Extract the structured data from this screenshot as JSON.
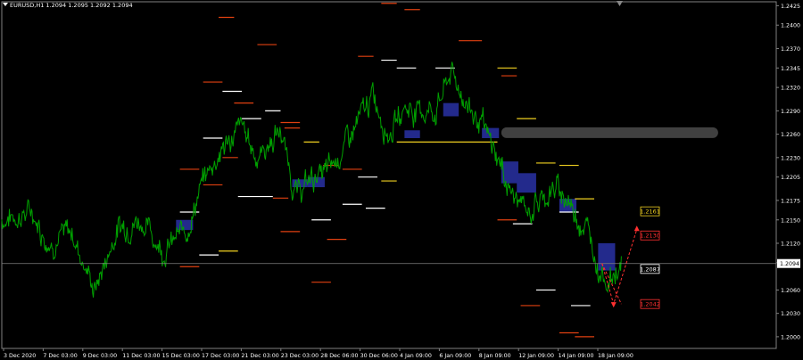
{
  "header": {
    "title": "EURUSD,H1  1.2094 1.2095 1.2092 1.2094"
  },
  "colors": {
    "background": "#000000",
    "price_line": "#00a000",
    "grid_frame": "#808080",
    "axis_text": "#ffffff",
    "blue_box": "#232a8c",
    "red_level": "#e04010",
    "white_level": "#ffffff",
    "yellow_level": "#f0d020",
    "forecast_red": "#ff3030",
    "gray_band": "#404040"
  },
  "icons": {
    "scroll": "chart-shift-icon"
  },
  "chart_data": {
    "type": "line",
    "symbol": "EURUSD",
    "timeframe": "H1",
    "ylim": [
      1.1985,
      1.243
    ],
    "y_ticks": [
      "1.2425",
      "1.2400",
      "1.2370",
      "1.2345",
      "1.2320",
      "1.2290",
      "1.2260",
      "1.2230",
      "1.2205",
      "1.2175",
      "1.2150",
      "1.2120",
      "1.2095",
      "1.2060",
      "1.2030",
      "1.2000"
    ],
    "x_ticks": [
      "3 Dec 2020",
      "7 Dec 03:00",
      "9 Dec 03:00",
      "11 Dec 03:00",
      "15 Dec 03:00",
      "17 Dec 03:00",
      "21 Dec 03:00",
      "23 Dec 03:00",
      "28 Dec 06:00",
      "30 Dec 06:00",
      "4 Jan 09:00",
      "6 Jan 09:00",
      "8 Jan 09:00",
      "12 Jan 09:00",
      "14 Jan 09:00",
      "18 Jan 09:00"
    ],
    "current_price": "1.2094",
    "price_labels": [
      {
        "text": "1.2161",
        "value": 1.2161,
        "color": "#f0d020"
      },
      {
        "text": "1.2130",
        "value": 1.213,
        "color": "#ff3030"
      },
      {
        "text": "1.2087",
        "value": 1.2087,
        "color": "#ffffff"
      },
      {
        "text": "1.2042",
        "value": 1.2042,
        "color": "#ff3030"
      }
    ],
    "price_anchors": [
      {
        "x": 0,
        "y": 1.215
      },
      {
        "x": 0.04,
        "y": 1.216
      },
      {
        "x": 0.06,
        "y": 1.212
      },
      {
        "x": 0.09,
        "y": 1.2135
      },
      {
        "x": 0.12,
        "y": 1.206
      },
      {
        "x": 0.15,
        "y": 1.214
      },
      {
        "x": 0.18,
        "y": 1.215
      },
      {
        "x": 0.21,
        "y": 1.211
      },
      {
        "x": 0.24,
        "y": 1.214
      },
      {
        "x": 0.26,
        "y": 1.22
      },
      {
        "x": 0.28,
        "y": 1.2235
      },
      {
        "x": 0.31,
        "y": 1.227
      },
      {
        "x": 0.33,
        "y": 1.223
      },
      {
        "x": 0.36,
        "y": 1.2265
      },
      {
        "x": 0.38,
        "y": 1.218
      },
      {
        "x": 0.4,
        "y": 1.2205
      },
      {
        "x": 0.42,
        "y": 1.221
      },
      {
        "x": 0.44,
        "y": 1.224
      },
      {
        "x": 0.46,
        "y": 1.2275
      },
      {
        "x": 0.48,
        "y": 1.231
      },
      {
        "x": 0.5,
        "y": 1.226
      },
      {
        "x": 0.52,
        "y": 1.2295
      },
      {
        "x": 0.54,
        "y": 1.229
      },
      {
        "x": 0.56,
        "y": 1.229
      },
      {
        "x": 0.58,
        "y": 1.234
      },
      {
        "x": 0.6,
        "y": 1.23
      },
      {
        "x": 0.62,
        "y": 1.227
      },
      {
        "x": 0.64,
        "y": 1.223
      },
      {
        "x": 0.66,
        "y": 1.218
      },
      {
        "x": 0.68,
        "y": 1.216
      },
      {
        "x": 0.7,
        "y": 1.218
      },
      {
        "x": 0.72,
        "y": 1.219
      },
      {
        "x": 0.74,
        "y": 1.216
      },
      {
        "x": 0.76,
        "y": 1.213
      },
      {
        "x": 0.77,
        "y": 1.209
      },
      {
        "x": 0.785,
        "y": 1.207
      },
      {
        "x": 0.8,
        "y": 1.2094
      }
    ],
    "levels": [
      {
        "x": 0.49,
        "w": 0.02,
        "y": 1.2428,
        "color": "red"
      },
      {
        "x": 0.52,
        "w": 0.02,
        "y": 1.242,
        "color": "red"
      },
      {
        "x": 0.28,
        "w": 0.02,
        "y": 1.241,
        "color": "red"
      },
      {
        "x": 0.59,
        "w": 0.03,
        "y": 1.238,
        "color": "red"
      },
      {
        "x": 0.33,
        "w": 0.025,
        "y": 1.2375,
        "color": "red"
      },
      {
        "x": 0.46,
        "w": 0.02,
        "y": 1.236,
        "color": "red"
      },
      {
        "x": 0.49,
        "w": 0.02,
        "y": 1.2355,
        "color": "white"
      },
      {
        "x": 0.51,
        "w": 0.025,
        "y": 1.2345,
        "color": "white"
      },
      {
        "x": 0.56,
        "w": 0.025,
        "y": 1.2345,
        "color": "white"
      },
      {
        "x": 0.64,
        "w": 0.025,
        "y": 1.2345,
        "color": "yellow"
      },
      {
        "x": 0.645,
        "w": 0.02,
        "y": 1.2335,
        "color": "red"
      },
      {
        "x": 0.26,
        "w": 0.025,
        "y": 1.2327,
        "color": "red"
      },
      {
        "x": 0.285,
        "w": 0.025,
        "y": 1.2315,
        "color": "white"
      },
      {
        "x": 0.3,
        "w": 0.025,
        "y": 1.23,
        "color": "red"
      },
      {
        "x": 0.34,
        "w": 0.02,
        "y": 1.229,
        "color": "white"
      },
      {
        "x": 0.31,
        "w": 0.025,
        "y": 1.228,
        "color": "white"
      },
      {
        "x": 0.665,
        "w": 0.025,
        "y": 1.228,
        "color": "yellow"
      },
      {
        "x": 0.36,
        "w": 0.025,
        "y": 1.2275,
        "color": "red"
      },
      {
        "x": 0.365,
        "w": 0.02,
        "y": 1.2268,
        "color": "red"
      },
      {
        "x": 0.26,
        "w": 0.025,
        "y": 1.2255,
        "color": "white"
      },
      {
        "x": 0.39,
        "w": 0.02,
        "y": 1.225,
        "color": "yellow"
      },
      {
        "x": 0.285,
        "w": 0.02,
        "y": 1.223,
        "color": "red"
      },
      {
        "x": 0.69,
        "w": 0.025,
        "y": 1.2223,
        "color": "yellow"
      },
      {
        "x": 0.72,
        "w": 0.025,
        "y": 1.222,
        "color": "yellow"
      },
      {
        "x": 0.415,
        "w": 0.02,
        "y": 1.222,
        "color": "red"
      },
      {
        "x": 0.23,
        "w": 0.025,
        "y": 1.2215,
        "color": "red"
      },
      {
        "x": 0.44,
        "w": 0.025,
        "y": 1.2215,
        "color": "red"
      },
      {
        "x": 0.46,
        "w": 0.025,
        "y": 1.2205,
        "color": "white"
      },
      {
        "x": 0.49,
        "w": 0.02,
        "y": 1.22,
        "color": "yellow"
      },
      {
        "x": 0.26,
        "w": 0.025,
        "y": 1.2195,
        "color": "red"
      },
      {
        "x": 0.305,
        "w": 0.045,
        "y": 1.218,
        "color": "white"
      },
      {
        "x": 0.35,
        "w": 0.02,
        "y": 1.2178,
        "color": "red"
      },
      {
        "x": 0.44,
        "w": 0.025,
        "y": 1.217,
        "color": "white"
      },
      {
        "x": 0.47,
        "w": 0.025,
        "y": 1.2165,
        "color": "white"
      },
      {
        "x": 0.74,
        "w": 0.025,
        "y": 1.2177,
        "color": "yellow"
      },
      {
        "x": 0.23,
        "w": 0.025,
        "y": 1.216,
        "color": "white"
      },
      {
        "x": 0.4,
        "w": 0.025,
        "y": 1.215,
        "color": "white"
      },
      {
        "x": 0.64,
        "w": 0.025,
        "y": 1.215,
        "color": "red"
      },
      {
        "x": 0.66,
        "w": 0.025,
        "y": 1.2145,
        "color": "white"
      },
      {
        "x": 0.72,
        "w": 0.025,
        "y": 1.216,
        "color": "white"
      },
      {
        "x": 0.36,
        "w": 0.025,
        "y": 1.2135,
        "color": "red"
      },
      {
        "x": 0.42,
        "w": 0.025,
        "y": 1.2125,
        "color": "red"
      },
      {
        "x": 0.28,
        "w": 0.025,
        "y": 1.211,
        "color": "yellow"
      },
      {
        "x": 0.255,
        "w": 0.025,
        "y": 1.2105,
        "color": "white"
      },
      {
        "x": 0.23,
        "w": 0.025,
        "y": 1.209,
        "color": "red"
      },
      {
        "x": 0.4,
        "w": 0.025,
        "y": 1.207,
        "color": "red"
      },
      {
        "x": 0.69,
        "w": 0.025,
        "y": 1.206,
        "color": "white"
      },
      {
        "x": 0.735,
        "w": 0.025,
        "y": 1.204,
        "color": "white"
      },
      {
        "x": 0.67,
        "w": 0.025,
        "y": 1.204,
        "color": "red"
      },
      {
        "x": 0.72,
        "w": 0.025,
        "y": 1.2005,
        "color": "red"
      },
      {
        "x": 0.74,
        "w": 0.025,
        "y": 1.2,
        "color": "red"
      }
    ],
    "boxes": [
      {
        "x": 0.225,
        "w": 0.022,
        "top": 1.215,
        "bottom": 1.2137
      },
      {
        "x": 0.375,
        "w": 0.02,
        "top": 1.2202,
        "bottom": 1.2192
      },
      {
        "x": 0.395,
        "w": 0.022,
        "top": 1.2205,
        "bottom": 1.2192
      },
      {
        "x": 0.52,
        "w": 0.02,
        "top": 1.2265,
        "bottom": 1.2255
      },
      {
        "x": 0.57,
        "w": 0.02,
        "top": 1.23,
        "bottom": 1.2283
      },
      {
        "x": 0.62,
        "w": 0.022,
        "top": 1.2268,
        "bottom": 1.2255
      },
      {
        "x": 0.645,
        "w": 0.022,
        "top": 1.2225,
        "bottom": 1.2197
      },
      {
        "x": 0.665,
        "w": 0.025,
        "top": 1.221,
        "bottom": 1.2185
      },
      {
        "x": 0.72,
        "w": 0.022,
        "top": 1.2177,
        "bottom": 1.216
      },
      {
        "x": 0.77,
        "w": 0.022,
        "top": 1.212,
        "bottom": 1.2085
      }
    ],
    "gray_band": {
      "x": 0.645,
      "w": 0.28,
      "y": 1.2262
    },
    "forecast": [
      {
        "x": 0.775,
        "y": 1.2094
      },
      {
        "x": 0.79,
        "y": 1.2042
      },
      {
        "x": 0.82,
        "y": 1.2138
      },
      {
        "x": 0.775,
        "y": 1.2094
      },
      {
        "x": 0.8,
        "y": 1.2042
      }
    ]
  }
}
